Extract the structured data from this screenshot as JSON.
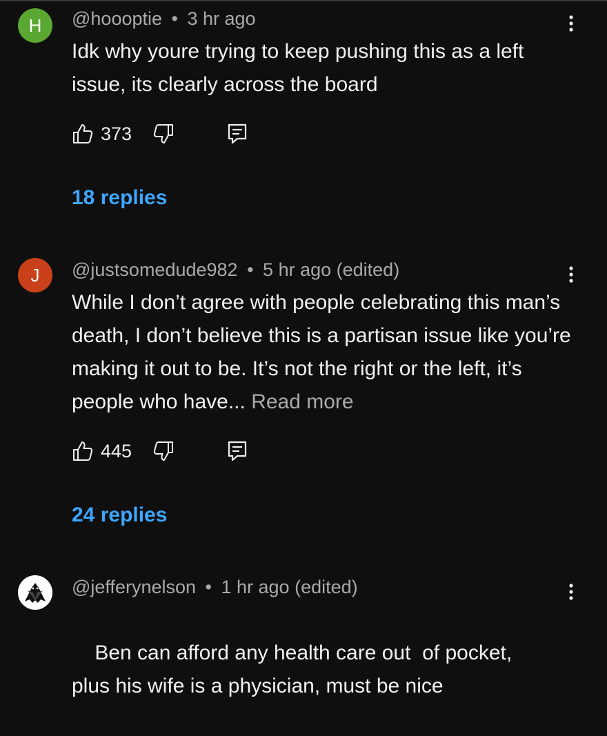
{
  "comments": [
    {
      "avatar_letter": "H",
      "avatar_color": "#5aa732",
      "handle": "@hoooptie",
      "separator": "•",
      "time": "3 hr ago",
      "edited": "",
      "text": "Idk why youre trying to keep pushing this as a left issue, its clearly across the board",
      "read_more": "",
      "likes": "373",
      "replies": "18 replies"
    },
    {
      "avatar_letter": "J",
      "avatar_color": "#c9411b",
      "handle": "@justsomedude982",
      "separator": "•",
      "time": "5 hr ago",
      "edited": "(edited)",
      "text": "While I don’t agree with people celebrating this man’s death, I don’t believe this is a partisan issue like you’re making it out to be. It’s not the right or the left, it’s people who have...",
      "read_more": "Read more",
      "likes": "445",
      "replies": "24 replies"
    },
    {
      "avatar_letter": "",
      "avatar_color": "#ffffff",
      "handle": "@jefferynelson",
      "separator": "•",
      "time": "1 hr ago",
      "edited": "(edited)",
      "text": "Ben can afford any health care out  of pocket, plus his wife is a physician, must be nice",
      "read_more": "",
      "likes": "",
      "replies": ""
    }
  ],
  "icons": {
    "like": "thumb-up-icon",
    "dislike": "thumb-down-icon",
    "reply": "reply-comment-icon",
    "more": "more-vertical-icon"
  },
  "colors": {
    "background": "#0f0f0f",
    "text": "#f1f1f1",
    "secondary_text": "#aaaaaa",
    "link": "#3ea6ff"
  }
}
